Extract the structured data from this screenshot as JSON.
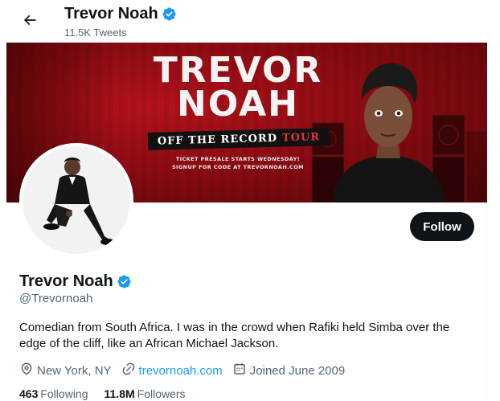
{
  "header": {
    "back_icon": "arrow-left-icon",
    "title": "Trevor Noah",
    "tweet_count": "11.5K Tweets"
  },
  "banner": {
    "headline_line1": "TREVOR",
    "headline_line2": "NOAH",
    "ribbon_main": "OFF THE RECORD",
    "ribbon_tour": "TOUR",
    "small_line1": "TICKET PRESALE STARTS WEDNESDAY!",
    "small_line2": "SIGNUP FOR CODE AT TREVORNOAH.COM"
  },
  "profile": {
    "name": "Trevor Noah",
    "handle": "@Trevornoah",
    "verified": true,
    "bio": "Comedian from South Africa. I was in the crowd when Rafiki held Simba over the edge of the cliff, like an African Michael Jackson.",
    "location": "New York, NY",
    "website": "trevornoah.com",
    "joined": "Joined June 2009"
  },
  "actions": {
    "follow_label": "Follow"
  },
  "stats": {
    "following_count": "463",
    "following_label": "Following",
    "followers_count": "11.8M",
    "followers_label": "Followers"
  },
  "colors": {
    "accent": "#1d9bf0",
    "text": "#0f1419",
    "secondary": "#536471",
    "banner_red": "#b5121b"
  }
}
